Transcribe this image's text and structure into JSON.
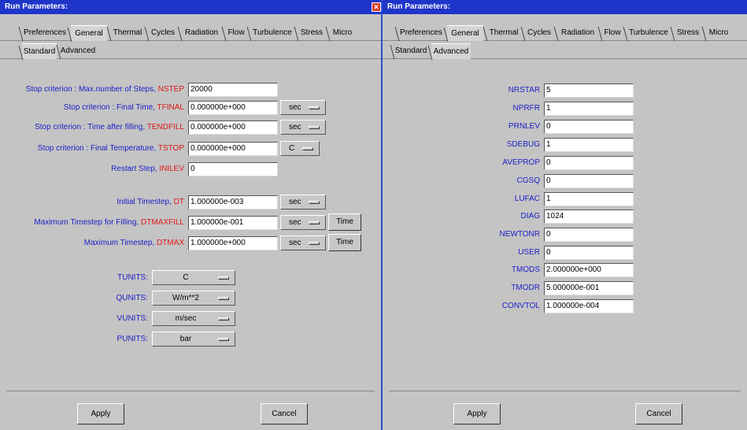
{
  "left": {
    "title": "Run Parameters:",
    "tabs": [
      "Preferences",
      "General",
      "Thermal",
      "Cycles",
      "Radiation",
      "Flow",
      "Turbulence",
      "Stress",
      "Micro"
    ],
    "active_tab": "General",
    "subtabs": [
      "Standard",
      "Advanced"
    ],
    "active_subtab": "Standard",
    "rows": [
      {
        "label": "Stop criterion : Max.number of Steps, ",
        "key": "NSTEP",
        "value": "20000"
      },
      {
        "label": "Stop criterion : Final Time, ",
        "key": "TFINAL",
        "value": "0.000000e+000",
        "unit": "sec"
      },
      {
        "label": "Stop criterion : Time after filling, ",
        "key": "TENDFILL",
        "value": "0.000000e+000",
        "unit": "sec"
      },
      {
        "label": "Stop criterion : Final Temperature, ",
        "key": "TSTOP",
        "value": "0.000000e+000",
        "unit": "C"
      },
      {
        "label": "Restart Step, ",
        "key": "INILEV",
        "value": "0"
      },
      {
        "label": "Initial Timestep, ",
        "key": "DT",
        "value": "1.000000e-003",
        "unit": "sec"
      },
      {
        "label": "Maximum Timestep for Filling, ",
        "key": "DTMAXFILL",
        "value": "1.000000e-001",
        "unit": "sec",
        "button": "Time"
      },
      {
        "label": "Maximum Timestep, ",
        "key": "DTMAX",
        "value": "1.000000e+000",
        "unit": "sec",
        "button": "Time"
      }
    ],
    "units": [
      {
        "label": "TUNITS:",
        "value": "C"
      },
      {
        "label": "QUNITS:",
        "value": "W/m**2"
      },
      {
        "label": "VUNITS:",
        "value": "m/sec"
      },
      {
        "label": "PUNITS:",
        "value": "bar"
      }
    ],
    "apply": "Apply",
    "cancel": "Cancel"
  },
  "right": {
    "title": "Run Parameters:",
    "tabs": [
      "Preferences",
      "General",
      "Thermal",
      "Cycles",
      "Radiation",
      "Flow",
      "Turbulence",
      "Stress",
      "Micro"
    ],
    "active_tab": "General",
    "subtabs": [
      "Standard",
      "Advanced"
    ],
    "active_subtab": "Advanced",
    "rows": [
      {
        "key": "NRSTAR",
        "value": "5"
      },
      {
        "key": "NPRFR",
        "value": "1"
      },
      {
        "key": "PRNLEV",
        "value": "0"
      },
      {
        "key": "SDEBUG",
        "value": "1"
      },
      {
        "key": "AVEPROP",
        "value": "0"
      },
      {
        "key": "CGSQ",
        "value": "0"
      },
      {
        "key": "LUFAC",
        "value": "1"
      },
      {
        "key": "DIAG",
        "value": "1024"
      },
      {
        "key": "NEWTONR",
        "value": "0"
      },
      {
        "key": "USER",
        "value": "0"
      },
      {
        "key": "TMODS",
        "value": "2.000000e+000"
      },
      {
        "key": "TMODR",
        "value": "5.000000e-001"
      },
      {
        "key": "CONVTOL",
        "value": "1.000000e-004"
      }
    ],
    "apply": "Apply",
    "cancel": "Cancel"
  },
  "colors": {
    "accent_blue": "#1b1fc7",
    "accent_red": "#e01818",
    "titlebar": "#1f35c9",
    "panel": "#c4c4c4"
  }
}
